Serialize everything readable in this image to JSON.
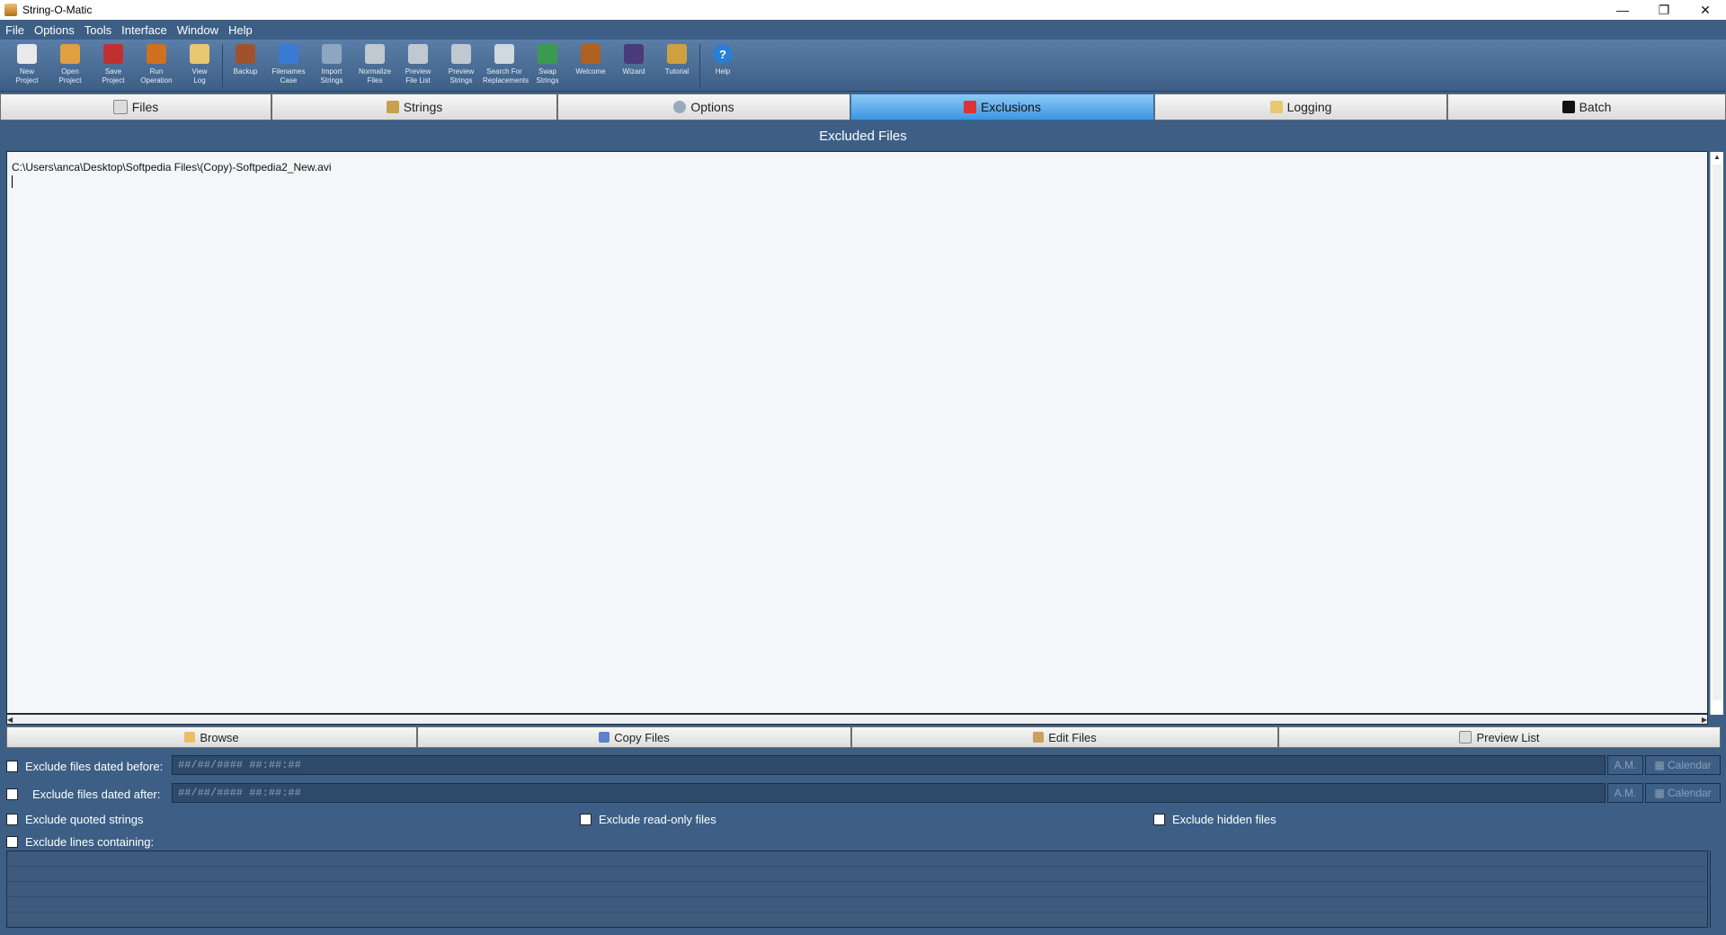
{
  "window": {
    "title": "String-O-Matic"
  },
  "menu": {
    "items": [
      "File",
      "Options",
      "Tools",
      "Interface",
      "Window",
      "Help"
    ]
  },
  "toolbar": {
    "buttons": [
      {
        "label": "New\nProject",
        "icon": "new-project-icon"
      },
      {
        "label": "Open\nProject",
        "icon": "open-project-icon"
      },
      {
        "label": "Save\nProject",
        "icon": "save-project-icon"
      },
      {
        "label": "Run\nOperation",
        "icon": "run-operation-icon"
      },
      {
        "label": "View\nLog",
        "icon": "view-log-icon"
      },
      {
        "label": "Backup",
        "icon": "backup-icon"
      },
      {
        "label": "Filenames\nCase",
        "icon": "filenames-case-icon"
      },
      {
        "label": "Import\nStrings",
        "icon": "import-strings-icon"
      },
      {
        "label": "Normalize\nFiles",
        "icon": "normalize-files-icon"
      },
      {
        "label": "Preview\nFile List",
        "icon": "preview-file-list-icon"
      },
      {
        "label": "Preview\nStrings",
        "icon": "preview-strings-icon"
      },
      {
        "label": "Search For\nReplacements",
        "icon": "search-replacements-icon"
      },
      {
        "label": "Swap\nStrings",
        "icon": "swap-strings-icon"
      },
      {
        "label": "Welcome",
        "icon": "welcome-icon"
      },
      {
        "label": "Wizard",
        "icon": "wizard-icon"
      },
      {
        "label": "Tutorial",
        "icon": "tutorial-icon"
      },
      {
        "label": "Help",
        "icon": "help-icon"
      }
    ]
  },
  "tabs": [
    {
      "label": "Files",
      "active": false
    },
    {
      "label": "Strings",
      "active": false
    },
    {
      "label": "Options",
      "active": false
    },
    {
      "label": "Exclusions",
      "active": true
    },
    {
      "label": "Logging",
      "active": false
    },
    {
      "label": "Batch",
      "active": false
    }
  ],
  "main": {
    "title": "Excluded Files",
    "excluded_files": [
      "C:\\Users\\anca\\Desktop\\Softpedia Files\\(Copy)-Softpedia2_New.avi"
    ]
  },
  "actions": {
    "browse": "Browse",
    "copy_files": "Copy Files",
    "edit_files": "Edit Files",
    "preview_list": "Preview List"
  },
  "filters": {
    "dated_before": {
      "label": "Exclude files dated before:",
      "placeholder": "##/##/#### ##:##:##",
      "ampm": "A.M.",
      "calendar": "Calendar",
      "checked": false
    },
    "dated_after": {
      "label": "Exclude files dated after:",
      "placeholder": "##/##/#### ##:##:##",
      "ampm": "A.M.",
      "calendar": "Calendar",
      "checked": false
    },
    "quoted_strings": {
      "label": "Exclude quoted strings",
      "checked": false
    },
    "read_only": {
      "label": "Exclude read-only files",
      "checked": false
    },
    "hidden": {
      "label": "Exclude hidden files",
      "checked": false
    },
    "lines_containing": {
      "label": "Exclude lines containing:",
      "checked": false
    }
  },
  "colors": {
    "background": "#3d5f86",
    "active_tab": "#3c95e2",
    "editor": "#f5f6f8"
  }
}
